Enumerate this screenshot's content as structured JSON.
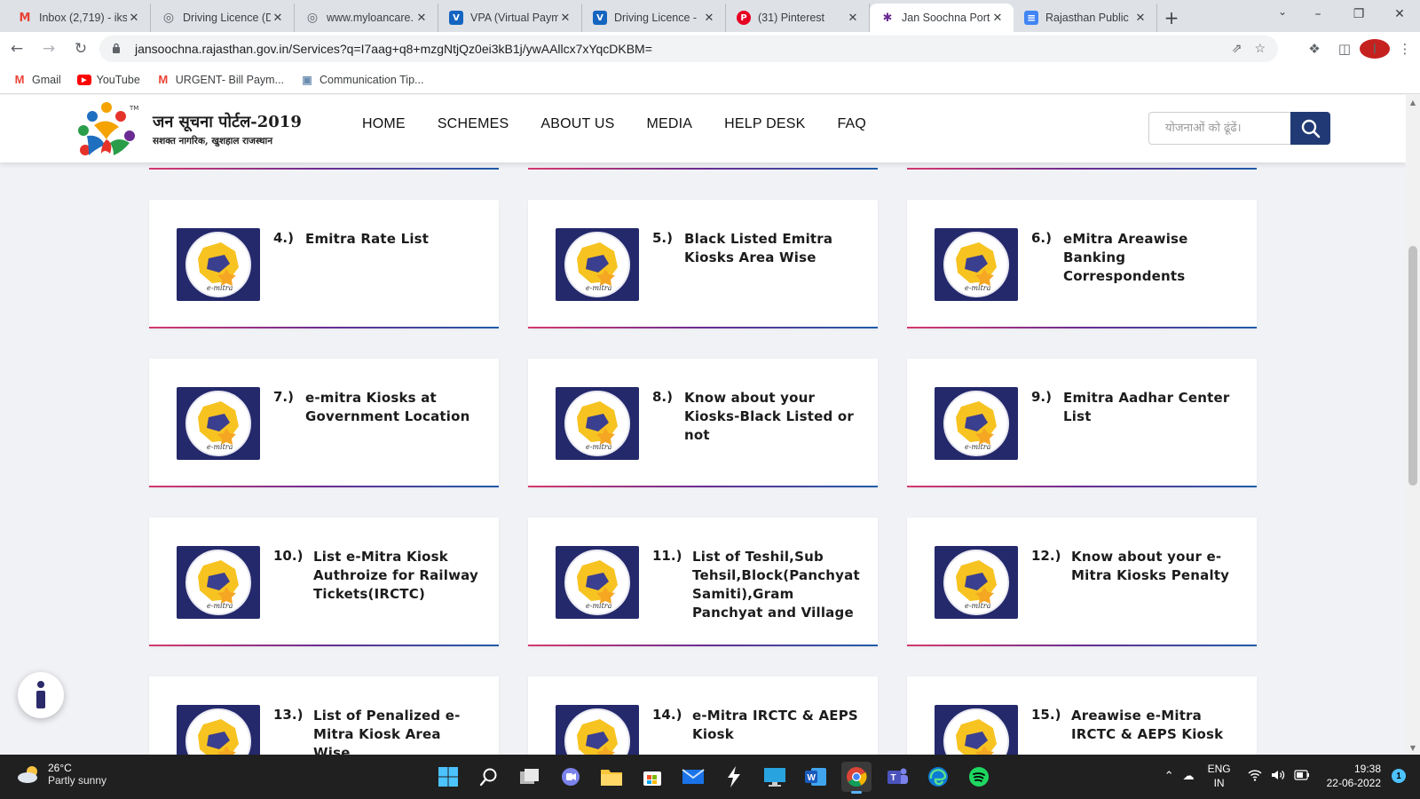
{
  "browser": {
    "tabs": [
      {
        "title": "Inbox (2,719) - iks",
        "icon": "gmail-icon",
        "color": "#ea4335"
      },
      {
        "title": "Driving Licence (D",
        "icon": "globe-icon",
        "color": "#5f6368"
      },
      {
        "title": "www.myloancare.",
        "icon": "globe-icon",
        "color": "#5f6368"
      },
      {
        "title": "VPA (Virtual Paym",
        "icon": "site-icon",
        "color": "#1565c0"
      },
      {
        "title": "Driving Licence -",
        "icon": "site-icon",
        "color": "#1565c0"
      },
      {
        "title": "(31) Pinterest",
        "icon": "pinterest-icon",
        "color": "#e60023"
      },
      {
        "title": "Jan Soochna Port",
        "icon": "jansoochna-icon",
        "color": "#6a2c93"
      },
      {
        "title": "Rajasthan Public",
        "icon": "docs-icon",
        "color": "#4285f4"
      }
    ],
    "active_tab": 6,
    "url": "jansoochna.rajasthan.gov.in/Services?q=I7aag+q8+mzgNtjQz0ei3kB1j/ywAAllcx7xYqcDKBM=",
    "profile_initial": "I",
    "bookmarks": [
      {
        "label": "Gmail",
        "icon": "gmail-icon"
      },
      {
        "label": "YouTube",
        "icon": "youtube-icon"
      },
      {
        "label": "URGENT- Bill Paym...",
        "icon": "gmail-icon"
      },
      {
        "label": "Communication Tip...",
        "icon": "image-icon"
      }
    ]
  },
  "site": {
    "logo_title": "जन सूचना पोर्टल-2019",
    "logo_subtitle": "सशक्त नागरिक, खुशहाल राजस्थान",
    "nav": [
      "HOME",
      "SCHEMES",
      "ABOUT US",
      "MEDIA",
      "HELP DESK",
      "FAQ"
    ],
    "search_placeholder": "योजनाओं को ढूंढें।",
    "accent_color": "#213a75"
  },
  "cards": [
    {
      "num": "4.)",
      "label": "Emitra Rate List"
    },
    {
      "num": "5.)",
      "label": "Black Listed Emitra Kiosks Area Wise"
    },
    {
      "num": "6.)",
      "label": "eMitra Areawise Banking Correspondents"
    },
    {
      "num": "7.)",
      "label": "e-mitra Kiosks at Government Location"
    },
    {
      "num": "8.)",
      "label": "Know about your Kiosks-Black Listed or not"
    },
    {
      "num": "9.)",
      "label": "Emitra Aadhar Center List"
    },
    {
      "num": "10.)",
      "label": "List e-Mitra Kiosk Authroize for Railway Tickets(IRCTC)"
    },
    {
      "num": "11.)",
      "label": "List of Teshil,Sub Tehsil,Block(Panchyat Samiti),Gram Panchyat and Village"
    },
    {
      "num": "12.)",
      "label": "Know about your e-Mitra Kiosks Penalty"
    },
    {
      "num": "13.)",
      "label": "List of Penalized e-Mitra Kiosk Area Wise"
    },
    {
      "num": "14.)",
      "label": "e-Mitra IRCTC & AEPS Kiosk"
    },
    {
      "num": "15.)",
      "label": "Areawise e-Mitra IRCTC & AEPS Kiosk"
    }
  ],
  "taskbar": {
    "temperature": "26°C",
    "condition": "Partly sunny",
    "lang_top": "ENG",
    "lang_bottom": "IN",
    "time": "19:38",
    "date": "22-06-2022",
    "notifications": "1"
  }
}
